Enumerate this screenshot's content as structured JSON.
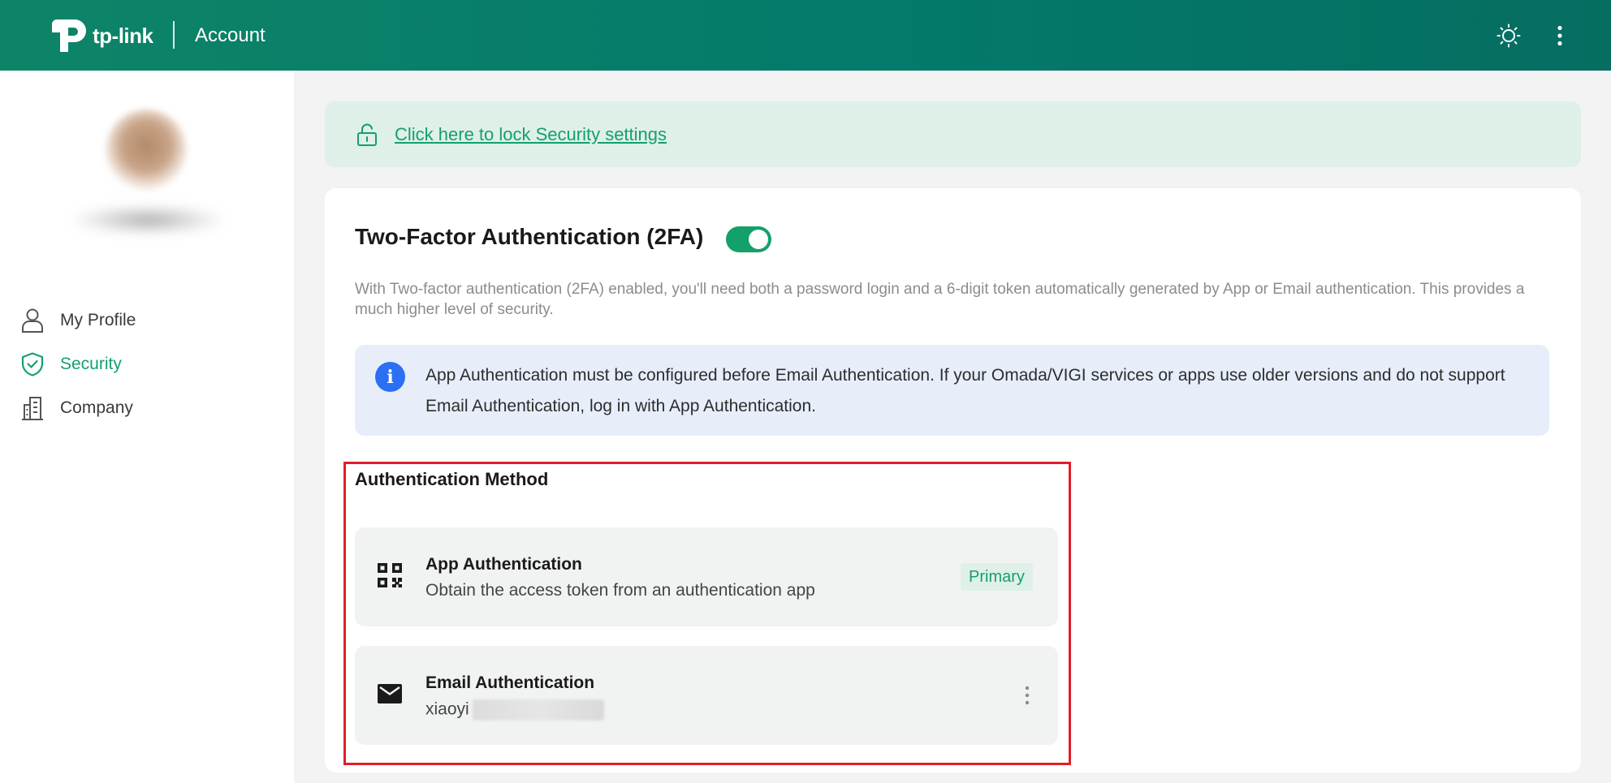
{
  "header": {
    "brand": "tp-link",
    "section_title": "Account",
    "theme_icon": "sun-icon",
    "menu_icon": "more-vertical-icon",
    "background_color": "#037a6b"
  },
  "sidebar": {
    "items": [
      {
        "label": "My Profile",
        "icon": "user-icon",
        "active": false
      },
      {
        "label": "Security",
        "icon": "shield-check-icon",
        "active": true
      },
      {
        "label": "Company",
        "icon": "building-icon",
        "active": false
      }
    ],
    "active_color": "#16a06f"
  },
  "lock_banner": {
    "icon": "unlock-icon",
    "link_text": "Click here to lock Security settings"
  },
  "twofa": {
    "title": "Two-Factor Authentication (2FA)",
    "enabled": true,
    "description": "With Two-factor authentication (2FA) enabled, you'll need both a password login and a 6-digit token automatically generated by App or Email authentication. This provides a much higher level of security.",
    "info": "App Authentication must be configured before Email Authentication. If your Omada/VIGI services or apps use older versions and do not support Email Authentication, log in with App Authentication.",
    "info_icon_glyph": "i"
  },
  "methods": {
    "title": "Authentication Method",
    "app": {
      "name": "App Authentication",
      "subtitle": "Obtain the access token from an authentication app",
      "badge": "Primary",
      "icon": "qr-code-icon"
    },
    "email": {
      "name": "Email Authentication",
      "address_visible": "xiaoyi",
      "icon": "mail-icon",
      "menu_icon": "more-vertical-icon"
    }
  },
  "colors": {
    "accent": "#14a06b",
    "info_blue": "#2b6ff2",
    "highlight_red": "#e01e2a"
  }
}
